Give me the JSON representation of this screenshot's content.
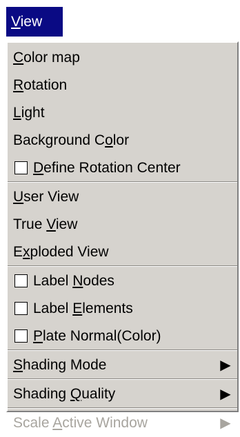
{
  "menubar": {
    "title": "View"
  },
  "menu": {
    "groups": [
      [
        {
          "label": "Color map",
          "mnemonic_index": 0,
          "checkbox": false,
          "submenu": false,
          "enabled": true
        },
        {
          "label": "Rotation",
          "mnemonic_index": 0,
          "checkbox": false,
          "submenu": false,
          "enabled": true
        },
        {
          "label": "Light",
          "mnemonic_index": 0,
          "checkbox": false,
          "submenu": false,
          "enabled": true
        },
        {
          "label": "Background Color",
          "mnemonic_index": 12,
          "checkbox": false,
          "submenu": false,
          "enabled": true
        },
        {
          "label": "Define Rotation Center",
          "mnemonic_index": 0,
          "checkbox": true,
          "checked": false,
          "submenu": false,
          "enabled": true
        }
      ],
      [
        {
          "label": "User View",
          "mnemonic_index": 0,
          "checkbox": false,
          "submenu": false,
          "enabled": true
        },
        {
          "label": "True View",
          "mnemonic_index": 5,
          "checkbox": false,
          "submenu": false,
          "enabled": true
        },
        {
          "label": "Exploded View",
          "mnemonic_index": 1,
          "checkbox": false,
          "submenu": false,
          "enabled": true
        }
      ],
      [
        {
          "label": "Label Nodes",
          "mnemonic_index": 6,
          "checkbox": true,
          "checked": false,
          "submenu": false,
          "enabled": true
        },
        {
          "label": "Label Elements",
          "mnemonic_index": 6,
          "checkbox": true,
          "checked": false,
          "submenu": false,
          "enabled": true
        },
        {
          "label": "Plate Normal(Color)",
          "mnemonic_index": 0,
          "checkbox": true,
          "checked": false,
          "submenu": false,
          "enabled": true
        }
      ],
      [
        {
          "label": "Shading Mode",
          "mnemonic_index": 0,
          "checkbox": false,
          "submenu": true,
          "enabled": true
        }
      ],
      [
        {
          "label": "Shading Quality",
          "mnemonic_index": 8,
          "checkbox": false,
          "submenu": true,
          "enabled": true
        }
      ],
      [
        {
          "label": "Scale Active Window",
          "mnemonic_index": 6,
          "checkbox": false,
          "submenu": true,
          "enabled": false
        }
      ]
    ]
  },
  "colors": {
    "menubar_active_bg": "#0a0a84",
    "menu_bg": "#d6d3ce",
    "disabled_text": "#a8a59f"
  },
  "icons": {
    "submenu_arrow": "triangle-right-icon",
    "checkbox": "checkbox-icon"
  }
}
